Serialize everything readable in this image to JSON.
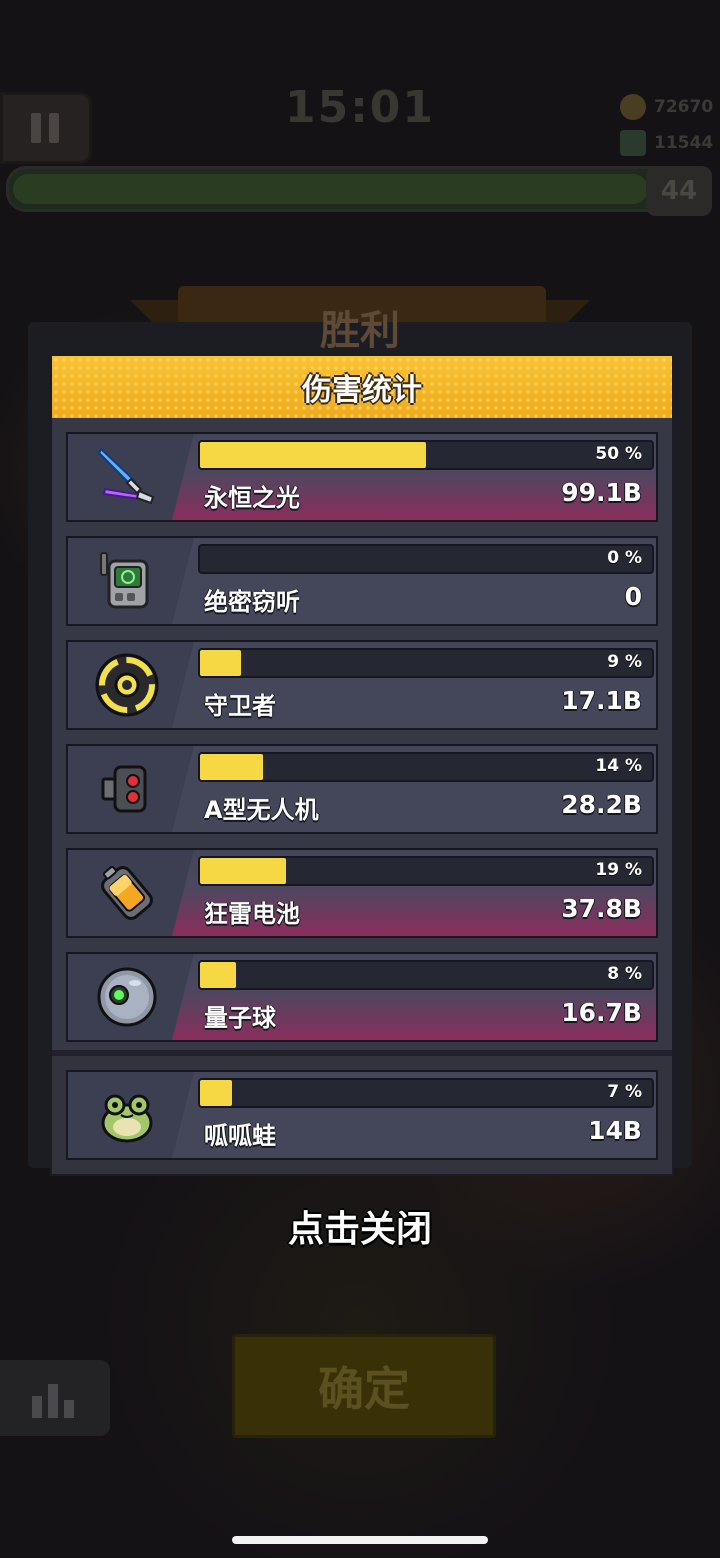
{
  "hud": {
    "timer": "15:01",
    "coins": "72670",
    "gems": "11544",
    "level": "44",
    "xp_fraction": 0.92
  },
  "victory_title": "胜利",
  "damage_panel": {
    "title": "伤害统计",
    "items": [
      {
        "name": "永恒之光",
        "percent_text": "50 %",
        "percent": 50,
        "damage": "99.1B",
        "icon": "dual-swords-icon"
      },
      {
        "name": "绝密窃听",
        "percent_text": "0 %",
        "percent": 0,
        "damage": "0",
        "icon": "radio-device-icon"
      },
      {
        "name": "守卫者",
        "percent_text": "9 %",
        "percent": 9,
        "damage": "17.1B",
        "icon": "guardian-shield-icon"
      },
      {
        "name": "A型无人机",
        "percent_text": "14 %",
        "percent": 14,
        "damage": "28.2B",
        "icon": "drone-icon"
      },
      {
        "name": "狂雷电池",
        "percent_text": "19 %",
        "percent": 19,
        "damage": "37.8B",
        "icon": "battery-icon"
      },
      {
        "name": "量子球",
        "percent_text": "8 %",
        "percent": 8,
        "damage": "16.7B",
        "icon": "quantum-orb-icon"
      }
    ],
    "extra": {
      "name": "呱呱蛙",
      "percent_text": "7 %",
      "percent": 7,
      "damage": "14B",
      "icon": "frog-icon"
    }
  },
  "close_hint": "点击关闭",
  "confirm_label": "确定",
  "colors": {
    "header_gold": "#f9c234",
    "bar_fill": "#f6d844",
    "panel_bg": "#363846",
    "row_highlight": "#8a2d5c"
  }
}
